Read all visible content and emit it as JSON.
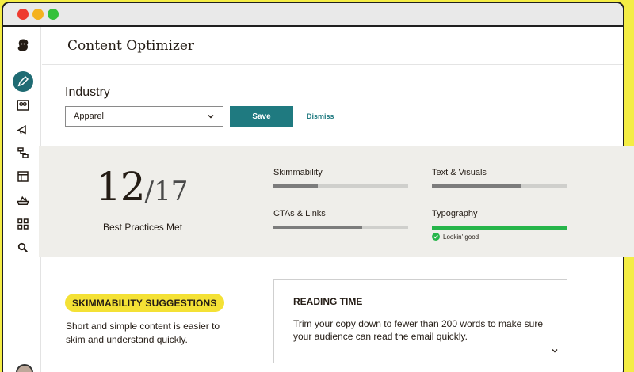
{
  "window": {
    "traffic_lights": [
      "close",
      "minimize",
      "zoom"
    ]
  },
  "sidebar": {
    "items": [
      {
        "icon": "mailchimp-logo-icon",
        "active": false
      },
      {
        "icon": "pencil-icon",
        "active": true
      },
      {
        "icon": "audience-icon",
        "active": false
      },
      {
        "icon": "megaphone-icon",
        "active": false
      },
      {
        "icon": "automations-icon",
        "active": false
      },
      {
        "icon": "website-icon",
        "active": false
      },
      {
        "icon": "content-icon",
        "active": false
      },
      {
        "icon": "integrations-grid-icon",
        "active": false
      },
      {
        "icon": "search-icon",
        "active": false
      }
    ]
  },
  "header": {
    "title": "Content Optimizer"
  },
  "industry": {
    "label": "Industry",
    "selected": "Apparel",
    "save_label": "Save",
    "dismiss_label": "Dismiss"
  },
  "score": {
    "met": "12",
    "total": "/17",
    "label": "Best Practices Met"
  },
  "metrics": [
    {
      "label": "Skimmability",
      "progress": 0.33
    },
    {
      "label": "Text & Visuals",
      "progress": 0.66
    },
    {
      "label": "CTAs & Links",
      "progress": 0.66
    },
    {
      "label": "Typography",
      "progress": 1.0,
      "status": "Lookin' good"
    }
  ],
  "suggestions": {
    "badge": "SKIMMABILITY SUGGESTIONS",
    "text": "Short and simple content is easier to skim and understand quickly."
  },
  "reading_time": {
    "title": "READING TIME",
    "text": "Trim your copy down to fewer than 200 words to make sure your audience can read the email quickly."
  },
  "colors": {
    "background_yellow": "#f4ed45",
    "accent_teal": "#1f7a80",
    "success_green": "#26b54a",
    "badge_yellow": "#f4e135"
  }
}
